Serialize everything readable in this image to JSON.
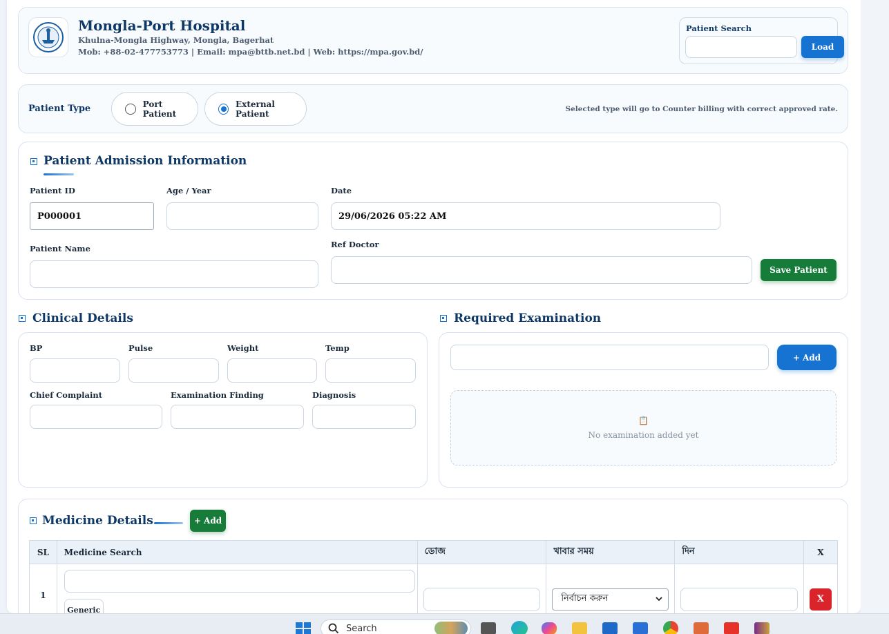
{
  "header": {
    "title": "Mongla-Port Hospital",
    "address": "Khulna-Mongla Highway, Mongla, Bagerhat",
    "contact": "Mob: +88-02-477753773 | Email: mpa@bttb.net.bd | Web: https://mpa.gov.bd/",
    "search_label": "Patient Search",
    "search_value": "",
    "load_label": "Load"
  },
  "patient_type": {
    "label": "Patient Type",
    "options": [
      "Port Patient",
      "External Patient"
    ],
    "selected": "External Patient",
    "note": "Selected type will go to Counter billing with correct approved rate."
  },
  "admission": {
    "title": "Patient Admission Information",
    "patient_id_label": "Patient ID",
    "patient_id_value": "P000001",
    "age_label": "Age / Year",
    "age_value": "",
    "date_label": "Date",
    "date_value": "29/06/2026 05:22 AM",
    "name_label": "Patient Name",
    "name_value": "",
    "ref_doctor_label": "Ref Doctor",
    "ref_doctor_value": "",
    "save_label": "Save Patient"
  },
  "clinical": {
    "title": "Clinical Details",
    "bp_label": "BP",
    "pulse_label": "Pulse",
    "weight_label": "Weight",
    "temp_label": "Temp",
    "complaint_label": "Chief Complaint",
    "finding_label": "Examination Finding",
    "diagnosis_label": "Diagnosis"
  },
  "examination": {
    "title": "Required Examination",
    "add_label": "+ Add",
    "empty_icon": "📋",
    "empty_text": "No examination added yet"
  },
  "medicine": {
    "title": "Medicine Details",
    "add_label": "+ Add",
    "columns": [
      "SL",
      "Medicine Search",
      "ডোজ",
      "খাবার সময়",
      "দিন",
      "X"
    ],
    "rows": [
      {
        "sl": "1",
        "medicine": "",
        "generic_label": "Generic",
        "dose": "",
        "meal_time": "নির্বাচন করুন",
        "days": "",
        "remove_label": "X"
      }
    ]
  },
  "taskbar": {
    "search_label": "Search"
  },
  "colors": {
    "primary": "#1673d1",
    "title": "#0e3866",
    "success": "#177b39",
    "danger": "#d9242c"
  }
}
